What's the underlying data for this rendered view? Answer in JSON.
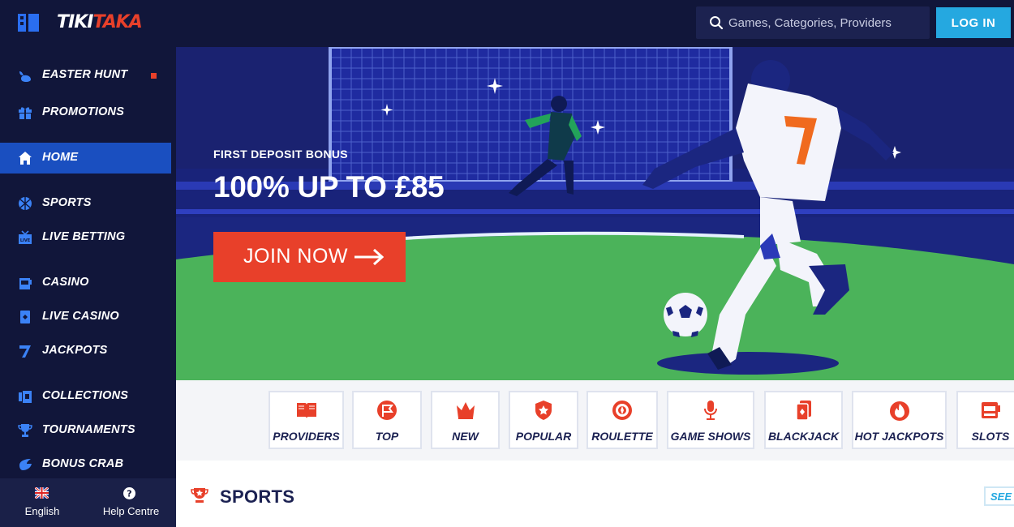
{
  "brand": {
    "logo_part1": "TIKI",
    "logo_part2": "TAKA",
    "accent": "#e8402a",
    "navy": "#11163a",
    "blue": "#1a4fc0",
    "cyan": "#25a8e0"
  },
  "header": {
    "search_placeholder": "Games, Categories, Providers",
    "login_label": "LOG IN"
  },
  "sidebar": {
    "items": [
      {
        "label": "EASTER HUNT",
        "icon": "bunny-icon",
        "badge": true
      },
      {
        "label": "PROMOTIONS",
        "icon": "gift-icon"
      },
      {
        "label": "HOME",
        "icon": "home-icon",
        "active": true
      },
      {
        "label": "SPORTS",
        "icon": "ball-icon"
      },
      {
        "label": "LIVE BETTING",
        "icon": "live-tv-icon"
      },
      {
        "label": "CASINO",
        "icon": "slot-machine-icon"
      },
      {
        "label": "LIVE CASINO",
        "icon": "card-icon"
      },
      {
        "label": "JACKPOTS",
        "icon": "seven-icon"
      },
      {
        "label": "COLLECTIONS",
        "icon": "collections-icon"
      },
      {
        "label": "TOURNAMENTS",
        "icon": "trophy-icon"
      },
      {
        "label": "BONUS CRAB",
        "icon": "crab-icon"
      }
    ],
    "language_label": "English",
    "help_label": "Help Centre"
  },
  "hero": {
    "kicker": "FIRST DEPOSIT BONUS",
    "title": "100% UP TO £85",
    "cta_label": "JOIN NOW"
  },
  "categories": [
    {
      "label": "PROVIDERS",
      "icon": "book-icon"
    },
    {
      "label": "TOP",
      "icon": "flag-icon"
    },
    {
      "label": "NEW",
      "icon": "crown-icon"
    },
    {
      "label": "POPULAR",
      "icon": "shield-star-icon"
    },
    {
      "label": "ROULETTE",
      "icon": "roulette-icon"
    },
    {
      "label": "GAME SHOWS",
      "icon": "microphone-icon"
    },
    {
      "label": "BLACKJACK",
      "icon": "cards-icon"
    },
    {
      "label": "HOT JACKPOTS",
      "icon": "fire-icon"
    },
    {
      "label": "SLOTS",
      "icon": "slot-icon"
    }
  ],
  "sports_section": {
    "title": "SPORTS",
    "see_all_label": "SEE ALL"
  }
}
